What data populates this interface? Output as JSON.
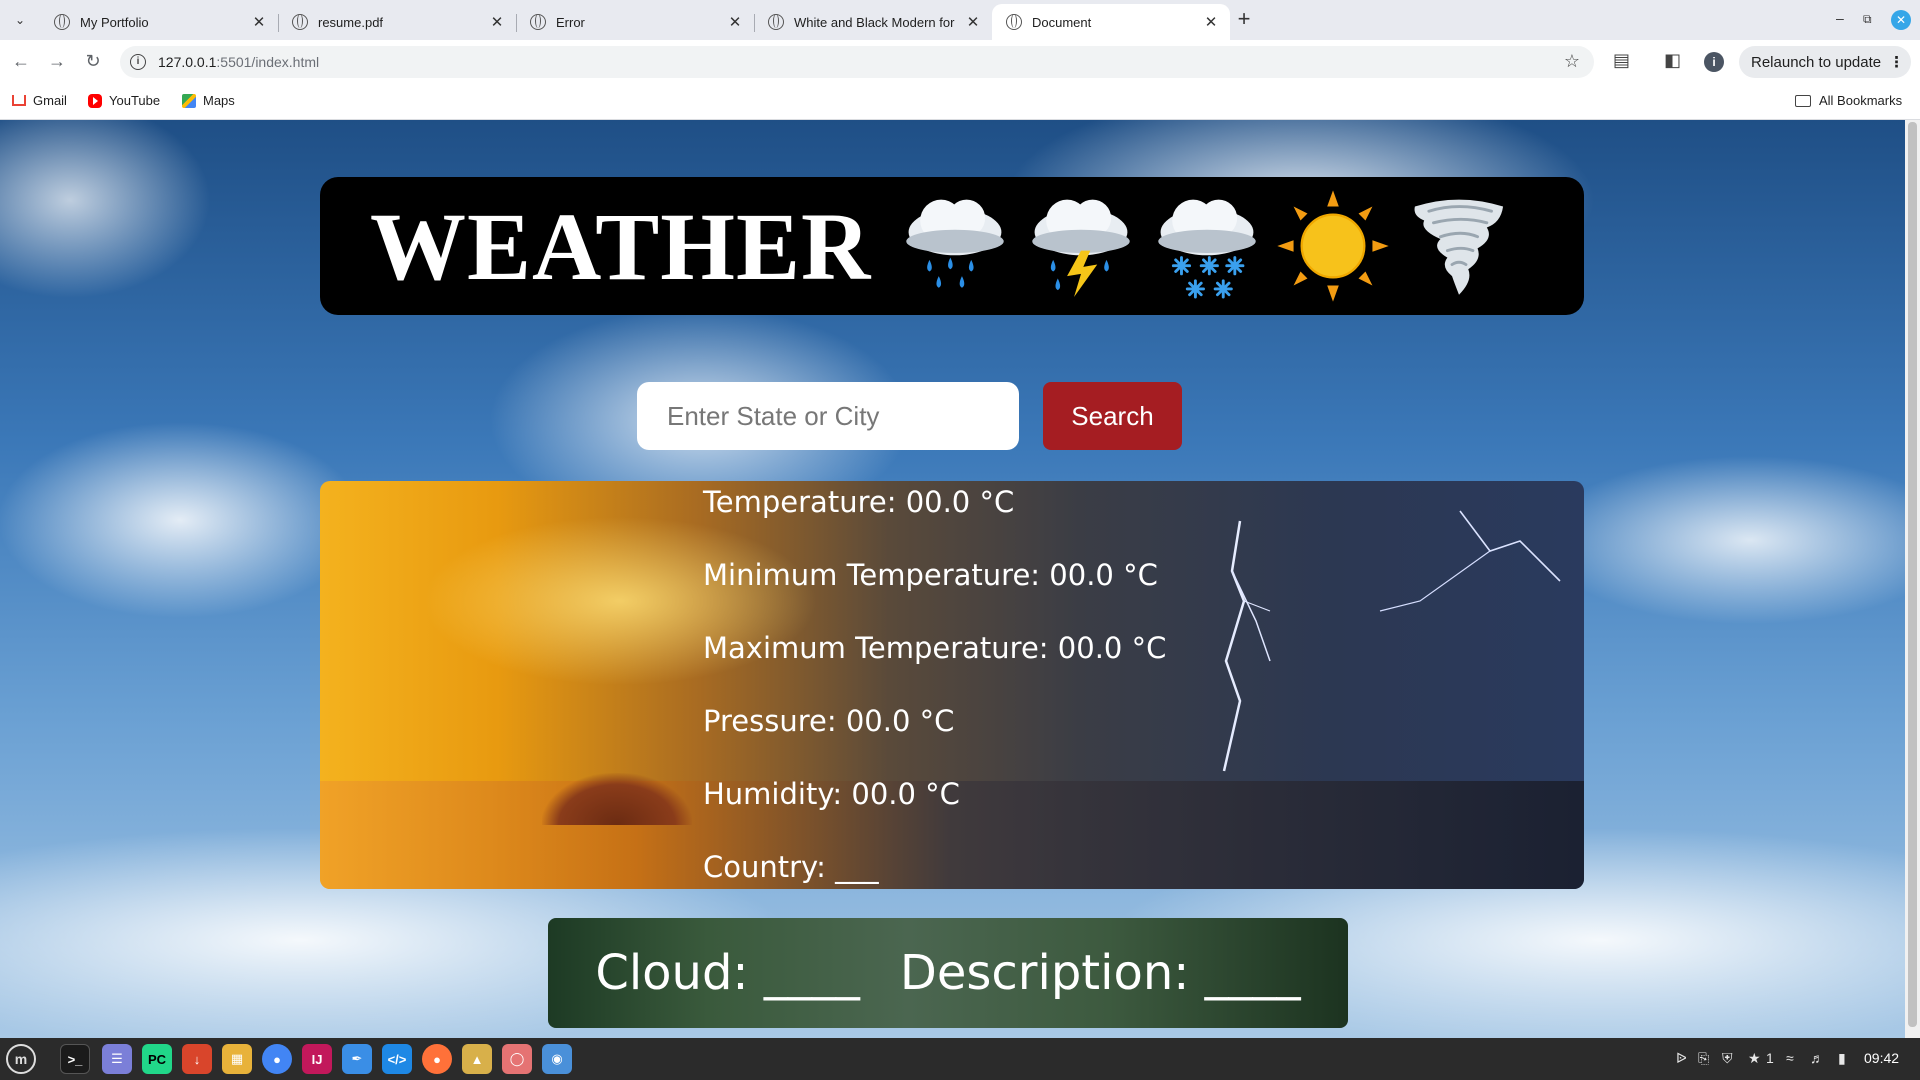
{
  "browser": {
    "tabs": [
      {
        "title": "My Portfolio",
        "active": false
      },
      {
        "title": "resume.pdf",
        "active": false
      },
      {
        "title": "Error",
        "active": false
      },
      {
        "title": "White and Black Modern for",
        "active": false
      },
      {
        "title": "Document",
        "active": true
      }
    ],
    "url_host": "127.0.0.1",
    "url_rest": ":5501/index.html",
    "relaunch_label": "Relaunch to update",
    "bookmarks": [
      "Gmail",
      "YouTube",
      "Maps"
    ],
    "all_bookmarks_label": "All Bookmarks"
  },
  "page": {
    "banner_title": "WEATHER",
    "weather_icons": [
      "rain-cloud-icon",
      "thunder-cloud-icon",
      "snow-cloud-icon",
      "sun-icon",
      "tornado-icon"
    ],
    "search": {
      "placeholder": "Enter State or City",
      "button_label": "Search"
    },
    "stats": [
      {
        "label": "Temperature: 00.0 °C"
      },
      {
        "label": "Minimum Temperature: 00.0 °C"
      },
      {
        "label": "Maximum Temperature: 00.0 °C"
      },
      {
        "label": "Pressure: 00.0 °C"
      },
      {
        "label": "Humidity: 00.0 °C"
      },
      {
        "label": "Country: ___"
      }
    ],
    "cloud_label": "Cloud: ____",
    "description_label": "Description: ____"
  },
  "taskbar": {
    "apps": [
      "terminal-icon",
      "notes-icon",
      "pycharm-icon",
      "downloader-icon",
      "files-icon",
      "chrome-icon",
      "intellij-icon",
      "text-editor-icon",
      "vscode-icon",
      "firefox-icon",
      "archive-icon",
      "viewer-icon",
      "screenshot-icon"
    ],
    "notification_count": "1",
    "clock": "09:42"
  },
  "colors": {
    "search_button": "#a51d22",
    "banner_bg": "#000000",
    "accent_blue": "#35a6e8"
  }
}
